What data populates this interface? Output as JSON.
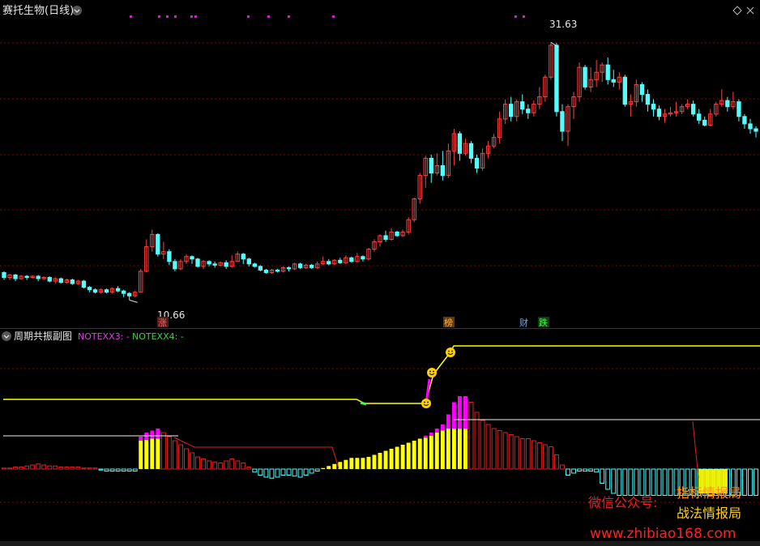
{
  "main_panel": {
    "title": "赛托生物(日线)",
    "high_label": "31.63",
    "low_label": "10.66",
    "markers": [
      "涨",
      "榜",
      "财",
      "跌"
    ]
  },
  "sub_panel": {
    "title": "周期共振副图",
    "legend": [
      {
        "text": "NOTEXX3: -",
        "color": "#e040e0"
      },
      {
        "text": "NOTEXX4: -",
        "color": "#40d040"
      }
    ]
  },
  "watermarks": {
    "line1a": "微信公众号:",
    "line1b": "指标情报局",
    "line2": "战法情报局",
    "line3": "www.zhibiao168.com"
  },
  "colors": {
    "up": "#ff4040",
    "down": "#54fcfc",
    "yellow": "#ffff00",
    "magenta": "#ff00ff",
    "grid": "#8b0000"
  },
  "chart_data": {
    "type": "candlestick",
    "price_range": [
      9.5,
      33.5
    ],
    "high": 31.63,
    "low": 10.66,
    "candles": [
      [
        12.9,
        12.5,
        13.0,
        12.3
      ],
      [
        12.5,
        12.7,
        12.8,
        12.3
      ],
      [
        12.7,
        12.4,
        12.8,
        12.2
      ],
      [
        12.4,
        12.6,
        12.7,
        12.3
      ],
      [
        12.6,
        12.5,
        12.7,
        12.3
      ],
      [
        12.5,
        12.6,
        12.7,
        12.4
      ],
      [
        12.6,
        12.4,
        12.7,
        12.2
      ],
      [
        12.4,
        12.5,
        12.6,
        12.3
      ],
      [
        12.5,
        12.2,
        12.6,
        12.1
      ],
      [
        12.2,
        12.4,
        12.5,
        12.0
      ],
      [
        12.4,
        12.1,
        12.5,
        12.0
      ],
      [
        12.1,
        12.3,
        12.4,
        12.0
      ],
      [
        12.3,
        12.0,
        12.4,
        11.9
      ],
      [
        12.0,
        12.2,
        12.3,
        11.9
      ],
      [
        12.2,
        11.7,
        12.3,
        11.6
      ],
      [
        11.7,
        11.5,
        11.8,
        11.3
      ],
      [
        11.5,
        11.3,
        11.6,
        11.2
      ],
      [
        11.3,
        11.5,
        11.6,
        11.2
      ],
      [
        11.5,
        11.3,
        11.6,
        11.2
      ],
      [
        11.3,
        11.6,
        11.7,
        11.2
      ],
      [
        11.6,
        11.4,
        11.8,
        11.3
      ],
      [
        11.4,
        11.2,
        11.5,
        10.9
      ],
      [
        11.2,
        11.0,
        11.3,
        10.66
      ],
      [
        11.0,
        11.3,
        11.4,
        10.9
      ],
      [
        11.3,
        13.0,
        13.2,
        11.3
      ],
      [
        13.0,
        15.0,
        15.6,
        12.9
      ],
      [
        15.0,
        16.0,
        16.4,
        14.6
      ],
      [
        16.0,
        14.4,
        16.1,
        14.2
      ],
      [
        14.4,
        14.6,
        15.4,
        14.0
      ],
      [
        14.6,
        13.8,
        14.8,
        13.5
      ],
      [
        13.8,
        13.2,
        14.0,
        13.0
      ],
      [
        13.2,
        13.8,
        14.0,
        13.1
      ],
      [
        13.8,
        14.2,
        14.4,
        13.6
      ],
      [
        14.2,
        14.0,
        14.3,
        13.6
      ],
      [
        14.0,
        13.4,
        14.1,
        13.3
      ],
      [
        13.4,
        13.8,
        13.9,
        13.2
      ],
      [
        13.8,
        13.6,
        13.9,
        13.4
      ],
      [
        13.6,
        13.5,
        13.8,
        13.3
      ],
      [
        13.5,
        13.7,
        13.8,
        13.4
      ],
      [
        13.7,
        13.4,
        13.9,
        13.2
      ],
      [
        13.4,
        13.8,
        14.3,
        13.3
      ],
      [
        13.8,
        14.4,
        14.6,
        13.8
      ],
      [
        14.4,
        14.0,
        14.5,
        13.6
      ],
      [
        14.0,
        13.6,
        14.1,
        13.4
      ],
      [
        13.6,
        13.4,
        13.7,
        13.3
      ],
      [
        13.4,
        13.1,
        13.5,
        13.0
      ],
      [
        13.1,
        12.9,
        13.2,
        12.8
      ],
      [
        12.9,
        13.1,
        13.2,
        12.8
      ],
      [
        13.1,
        13.0,
        13.2,
        12.9
      ],
      [
        13.0,
        13.3,
        13.4,
        12.9
      ],
      [
        13.3,
        13.2,
        13.4,
        13.0
      ],
      [
        13.2,
        13.6,
        13.7,
        13.1
      ],
      [
        13.6,
        13.3,
        13.7,
        13.2
      ],
      [
        13.3,
        13.5,
        13.6,
        13.2
      ],
      [
        13.5,
        13.3,
        13.6,
        13.2
      ],
      [
        13.3,
        13.6,
        13.8,
        13.2
      ],
      [
        13.6,
        13.8,
        14.2,
        13.5
      ],
      [
        13.8,
        13.6,
        14.0,
        13.5
      ],
      [
        13.6,
        13.9,
        14.0,
        13.5
      ],
      [
        13.9,
        13.7,
        14.1,
        13.6
      ],
      [
        13.7,
        14.1,
        14.3,
        13.6
      ],
      [
        14.1,
        13.8,
        14.2,
        13.7
      ],
      [
        13.8,
        14.2,
        14.5,
        13.7
      ],
      [
        14.2,
        14.0,
        14.3,
        13.8
      ],
      [
        14.0,
        14.8,
        14.9,
        13.9
      ],
      [
        14.8,
        15.4,
        15.6,
        14.6
      ],
      [
        15.4,
        15.9,
        16.0,
        15.0
      ],
      [
        15.9,
        15.6,
        16.3,
        15.4
      ],
      [
        15.6,
        16.2,
        16.5,
        15.5
      ],
      [
        16.2,
        15.9,
        16.3,
        15.8
      ],
      [
        15.9,
        16.2,
        16.4,
        15.8
      ],
      [
        16.2,
        17.2,
        17.4,
        16.0
      ],
      [
        17.2,
        18.9,
        19.0,
        17.0
      ],
      [
        18.9,
        20.8,
        21.0,
        18.5
      ],
      [
        20.8,
        22.2,
        22.4,
        19.8
      ],
      [
        22.2,
        21.0,
        22.5,
        20.2
      ],
      [
        21.0,
        21.6,
        22.6,
        20.8
      ],
      [
        21.6,
        20.8,
        22.8,
        20.4
      ],
      [
        20.8,
        22.8,
        23.4,
        20.6
      ],
      [
        22.8,
        24.2,
        24.6,
        21.6
      ],
      [
        24.2,
        22.6,
        24.4,
        22.0
      ],
      [
        22.6,
        23.4,
        23.8,
        22.4
      ],
      [
        23.4,
        22.2,
        23.6,
        21.8
      ],
      [
        22.2,
        21.4,
        22.5,
        21.0
      ],
      [
        21.4,
        22.6,
        23.0,
        21.2
      ],
      [
        22.6,
        23.2,
        23.6,
        22.2
      ],
      [
        23.2,
        23.9,
        24.2,
        23.0
      ],
      [
        23.9,
        25.4,
        26.0,
        23.4
      ],
      [
        25.4,
        26.6,
        27.0,
        25.0
      ],
      [
        26.6,
        25.6,
        27.2,
        25.2
      ],
      [
        25.6,
        26.8,
        27.0,
        25.2
      ],
      [
        26.8,
        26.2,
        27.4,
        25.8
      ],
      [
        26.2,
        25.9,
        26.6,
        25.4
      ],
      [
        25.9,
        26.6,
        26.9,
        25.6
      ],
      [
        26.6,
        27.2,
        28.0,
        26.2
      ],
      [
        27.2,
        28.8,
        29.0,
        26.8
      ],
      [
        28.8,
        31.4,
        31.63,
        28.6
      ],
      [
        31.4,
        26.0,
        31.6,
        25.6
      ],
      [
        26.0,
        24.4,
        26.6,
        23.6
      ],
      [
        24.4,
        26.4,
        26.6,
        23.2
      ],
      [
        26.4,
        27.2,
        27.6,
        25.4
      ],
      [
        27.2,
        29.6,
        30.0,
        26.8
      ],
      [
        29.6,
        28.0,
        29.8,
        27.8
      ],
      [
        28.0,
        28.6,
        29.6,
        27.6
      ],
      [
        28.6,
        29.2,
        30.2,
        28.0
      ],
      [
        29.2,
        29.8,
        30.0,
        28.4
      ],
      [
        29.8,
        28.6,
        30.4,
        28.2
      ],
      [
        28.6,
        28.4,
        29.4,
        28.0
      ],
      [
        28.4,
        28.8,
        29.2,
        27.8
      ],
      [
        28.8,
        26.6,
        29.0,
        26.4
      ],
      [
        26.6,
        26.8,
        27.4,
        25.6
      ],
      [
        26.8,
        28.2,
        28.6,
        26.4
      ],
      [
        28.2,
        27.4,
        28.4,
        26.8
      ],
      [
        27.4,
        26.6,
        27.8,
        26.0
      ],
      [
        26.6,
        26.2,
        27.0,
        25.6
      ],
      [
        26.2,
        25.6,
        26.5,
        25.3
      ],
      [
        25.6,
        25.8,
        26.2,
        25.1
      ],
      [
        25.8,
        25.9,
        26.4,
        25.6
      ],
      [
        25.9,
        26.0,
        26.8,
        25.6
      ],
      [
        26.0,
        26.4,
        26.6,
        25.8
      ],
      [
        26.4,
        26.6,
        27.0,
        26.2
      ],
      [
        26.6,
        25.8,
        26.9,
        25.6
      ],
      [
        25.8,
        25.3,
        26.2,
        25.0
      ],
      [
        25.3,
        24.9,
        25.6,
        24.8
      ],
      [
        24.9,
        25.8,
        26.2,
        24.8
      ],
      [
        25.8,
        26.6,
        26.8,
        25.6
      ],
      [
        26.6,
        26.9,
        27.8,
        26.4
      ],
      [
        26.9,
        26.4,
        27.2,
        26.0
      ],
      [
        26.4,
        26.8,
        27.6,
        26.2
      ],
      [
        26.8,
        25.6,
        27.0,
        25.2
      ],
      [
        25.6,
        25.0,
        25.8,
        24.6
      ],
      [
        25.0,
        24.6,
        25.4,
        24.2
      ],
      [
        24.6,
        24.4,
        24.8,
        23.9
      ]
    ],
    "sub_hist": [
      0.1,
      0.1,
      0.2,
      0.2,
      0.3,
      0.4,
      0.5,
      0.4,
      0.3,
      0.3,
      0.2,
      0.2,
      0.2,
      0.2,
      0.1,
      0.1,
      0.1,
      -0.1,
      -0.2,
      -0.2,
      -0.2,
      -0.2,
      -0.2,
      -0.2,
      3.2,
      3.6,
      3.8,
      4.0,
      3.6,
      3.2,
      2.8,
      2.4,
      2.0,
      1.6,
      1.2,
      1.0,
      0.8,
      0.7,
      0.6,
      0.8,
      1.0,
      0.8,
      0.6,
      0.2,
      -0.3,
      -0.6,
      -0.8,
      -0.9,
      -0.8,
      -0.6,
      -0.6,
      -0.7,
      -0.8,
      -0.6,
      -0.4,
      -0.2,
      0.1,
      0.3,
      0.5,
      0.7,
      0.9,
      1.1,
      1.1,
      1.1,
      1.2,
      1.4,
      1.6,
      1.8,
      2.0,
      2.2,
      2.4,
      2.6,
      2.8,
      3.0,
      3.3,
      3.6,
      4.0,
      4.4,
      5.4,
      6.6,
      7.2,
      7.2,
      6.6,
      5.6,
      4.8,
      4.4,
      4.0,
      3.8,
      3.6,
      3.4,
      3.2,
      3.0,
      3.0,
      2.8,
      2.6,
      2.4,
      2.2,
      1.4,
      0.4,
      -0.6,
      -0.4,
      -0.2,
      -0.2,
      -0.2,
      -0.3,
      -1.4,
      -2.0,
      -2.4,
      -2.6,
      -2.6,
      -2.6,
      -2.6,
      -2.6,
      -2.6,
      -2.6,
      -2.6,
      -2.6,
      -2.6,
      -2.6,
      -2.6,
      -2.6,
      -2.6,
      -2.6,
      -2.6,
      -2.6,
      -2.6,
      -2.6,
      -2.6,
      -2.6,
      -2.6,
      -2.6,
      -2.6,
      -2.6
    ],
    "sub_yellow": [
      0,
      0,
      0,
      0,
      0,
      0,
      0,
      0,
      0,
      0,
      0,
      0,
      0,
      0,
      0,
      0,
      0,
      0,
      0,
      0,
      0,
      0,
      0,
      0,
      2.8,
      2.9,
      3.0,
      3.0,
      0,
      0,
      0,
      0,
      0,
      0,
      0,
      0,
      0,
      0,
      0,
      0,
      0,
      0,
      0,
      0,
      0,
      0,
      0,
      0,
      0,
      0,
      0,
      0,
      0,
      0,
      0,
      0,
      0.1,
      0.3,
      0.5,
      0.7,
      0.9,
      1.1,
      1.1,
      1.1,
      1.2,
      1.4,
      1.6,
      1.8,
      2.0,
      2.2,
      2.4,
      2.6,
      2.8,
      3.0,
      3.1,
      3.3,
      3.6,
      3.8,
      4.0,
      4.0,
      4.0,
      4.0,
      0,
      0,
      0,
      0,
      0,
      0,
      0,
      0,
      0,
      0,
      0,
      0,
      0,
      0,
      0,
      0,
      0,
      0,
      0,
      0,
      0,
      0,
      0,
      0,
      0,
      0,
      0,
      0,
      0,
      0,
      0,
      0,
      0,
      0,
      0,
      0,
      0,
      0,
      0,
      0,
      0,
      0,
      0,
      0,
      0,
      0,
      0,
      0,
      0,
      0,
      0,
      0,
      0,
      0
    ]
  }
}
